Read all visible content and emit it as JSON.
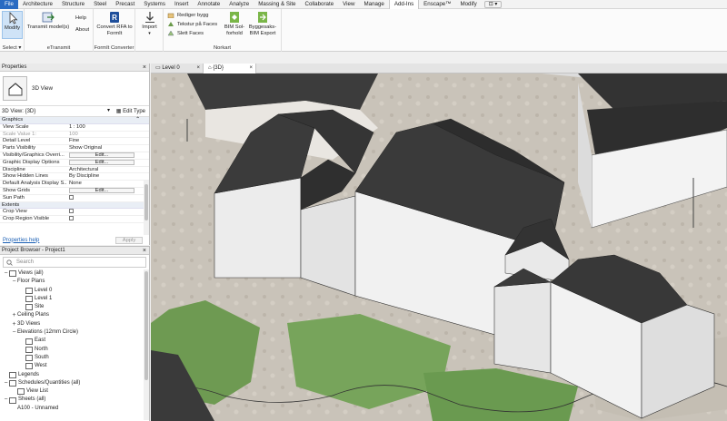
{
  "ribbon_tabs": [
    "File",
    "Architecture",
    "Structure",
    "Steel",
    "Precast",
    "Systems",
    "Insert",
    "Annotate",
    "Analyze",
    "Massing & Site",
    "Collaborate",
    "View",
    "Manage",
    "Add-Ins",
    "Enscape™",
    "Modify"
  ],
  "active_tab": "Add-Ins",
  "ribbon": {
    "select": {
      "modify_label": "Modify",
      "group_label": "Select ▾"
    },
    "etransmit": {
      "transmit_label": "Transmit model(s)",
      "help_label": "Help",
      "about_label": "About",
      "group_label": "eTransmit"
    },
    "formit": {
      "convert_label": "Convert RFA to FormIt",
      "group_label": "FormIt Converter"
    },
    "import": {
      "label": "Import"
    },
    "norkart": {
      "rediger_label": "Rediger bygg",
      "tekstur_label": "Tekstur på Faces",
      "slett_label": "Slett Faces",
      "bim_sol_label": "BIM Sol-forhold",
      "byggesaks_label": "Byggesaks-BIM Export",
      "group_label": "Norkart"
    }
  },
  "properties": {
    "title": "Properties",
    "type_name": "3D View",
    "selector_value": "3D View: {3D}",
    "edit_type_label": "Edit Type",
    "sections": {
      "graphics": "Graphics",
      "extents": "Extents"
    },
    "rows": [
      {
        "k": "View Scale",
        "v": "1 : 100"
      },
      {
        "k": "Scale Value    1:",
        "v": "100"
      },
      {
        "k": "Detail Level",
        "v": "Fine"
      },
      {
        "k": "Parts Visibility",
        "v": "Show Original"
      },
      {
        "k": "Visibility/Graphics Overri...",
        "v": "Edit..."
      },
      {
        "k": "Graphic Display Options",
        "v": "Edit..."
      },
      {
        "k": "Discipline",
        "v": "Architectural"
      },
      {
        "k": "Show Hidden Lines",
        "v": "By Discipline"
      },
      {
        "k": "Default Analysis Display S...",
        "v": "None"
      },
      {
        "k": "Show Grids",
        "v": "Edit..."
      },
      {
        "k": "Sun Path",
        "v": ""
      }
    ],
    "extents_rows": [
      {
        "k": "Crop View"
      },
      {
        "k": "Crop Region Visible"
      }
    ],
    "help_link": "Properties help",
    "apply_label": "Apply"
  },
  "browser": {
    "title": "Project Browser - Project1",
    "search_placeholder": "Search",
    "nodes": [
      {
        "label": "Views (all)",
        "level": 0,
        "tog": "−",
        "icon": true
      },
      {
        "label": "Floor Plans",
        "level": 1,
        "tog": "−"
      },
      {
        "label": "Level 0",
        "level": 2,
        "tog": "",
        "icon": true
      },
      {
        "label": "Level 1",
        "level": 2,
        "tog": "",
        "icon": true
      },
      {
        "label": "Site",
        "level": 2,
        "tog": "",
        "icon": true
      },
      {
        "label": "Ceiling Plans",
        "level": 1,
        "tog": "+"
      },
      {
        "label": "3D Views",
        "level": 1,
        "tog": "+"
      },
      {
        "label": "Elevations (12mm Circle)",
        "level": 1,
        "tog": "−"
      },
      {
        "label": "East",
        "level": 2,
        "tog": "",
        "icon": true
      },
      {
        "label": "North",
        "level": 2,
        "tog": "",
        "icon": true
      },
      {
        "label": "South",
        "level": 2,
        "tog": "",
        "icon": true
      },
      {
        "label": "West",
        "level": 2,
        "tog": "",
        "icon": true
      },
      {
        "label": "Legends",
        "level": 0,
        "tog": "",
        "icon": true
      },
      {
        "label": "Schedules/Quantities (all)",
        "level": 0,
        "tog": "−",
        "icon": true
      },
      {
        "label": "View List",
        "level": 1,
        "tog": "",
        "icon": true
      },
      {
        "label": "Sheets (all)",
        "level": 0,
        "tog": "−",
        "icon": true
      },
      {
        "label": "A100 - Unnamed",
        "level": 1,
        "tog": ""
      }
    ]
  },
  "view_tabs": [
    {
      "label": "Level 0",
      "active": false
    },
    {
      "label": "{3D}",
      "active": true
    }
  ],
  "colors": {
    "file_tab": "#2a6bc2",
    "roof": "#3a3a3a",
    "wall": "#e6e6e6",
    "grass": "#6e9a52"
  }
}
